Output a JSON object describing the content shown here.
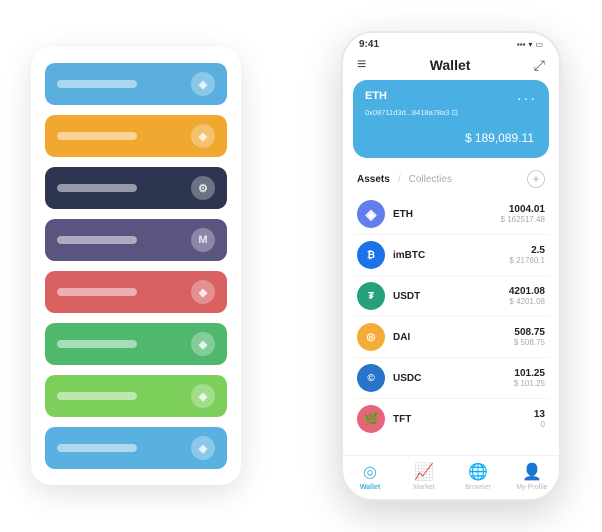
{
  "scene": {
    "background": "#ffffff"
  },
  "leftPanel": {
    "cards": [
      {
        "color": "card-blue",
        "icon": "◆"
      },
      {
        "color": "card-orange",
        "icon": "◈"
      },
      {
        "color": "card-dark",
        "icon": "⚙"
      },
      {
        "color": "card-purple",
        "icon": "M"
      },
      {
        "color": "card-red",
        "icon": "◆"
      },
      {
        "color": "card-green",
        "icon": "◆"
      },
      {
        "color": "card-lightgreen",
        "icon": "◆"
      },
      {
        "color": "card-bluelight",
        "icon": "◆"
      }
    ]
  },
  "phone": {
    "statusBar": {
      "time": "9:41",
      "signal": "▪▪▪",
      "wifi": "▾",
      "battery": "▭"
    },
    "header": {
      "menu": "≡",
      "title": "Wallet",
      "expand": "⤢"
    },
    "ethCard": {
      "label": "ETH",
      "address": "0x08711d3d...8418a78a3  ⊡",
      "dots": "···",
      "balancePrefix": "$",
      "balance": "189,089.11"
    },
    "assets": {
      "activeTab": "Assets",
      "divider": "/",
      "inactiveTab": "Collecties",
      "addIcon": "+"
    },
    "assetList": [
      {
        "name": "ETH",
        "icon": "◈",
        "iconClass": "asset-icon-eth",
        "amount": "1004.01",
        "usd": "$ 162517.48"
      },
      {
        "name": "imBTC",
        "icon": "₿",
        "iconClass": "asset-icon-imbtc",
        "amount": "2.5",
        "usd": "$ 21760.1"
      },
      {
        "name": "USDT",
        "icon": "₮",
        "iconClass": "asset-icon-usdt",
        "amount": "4201.08",
        "usd": "$ 4201.08"
      },
      {
        "name": "DAI",
        "icon": "◎",
        "iconClass": "asset-icon-dai",
        "amount": "508.75",
        "usd": "$ 508.75"
      },
      {
        "name": "USDC",
        "icon": "©",
        "iconClass": "asset-icon-usdc",
        "amount": "101.25",
        "usd": "$ 101.25"
      },
      {
        "name": "TFT",
        "icon": "🌿",
        "iconClass": "asset-icon-tft",
        "amount": "13",
        "usd": "0"
      }
    ],
    "nav": [
      {
        "icon": "◎",
        "label": "Wallet",
        "active": true
      },
      {
        "icon": "📈",
        "label": "Market",
        "active": false
      },
      {
        "icon": "🌐",
        "label": "Browser",
        "active": false
      },
      {
        "icon": "👤",
        "label": "My Profile",
        "active": false
      }
    ]
  }
}
